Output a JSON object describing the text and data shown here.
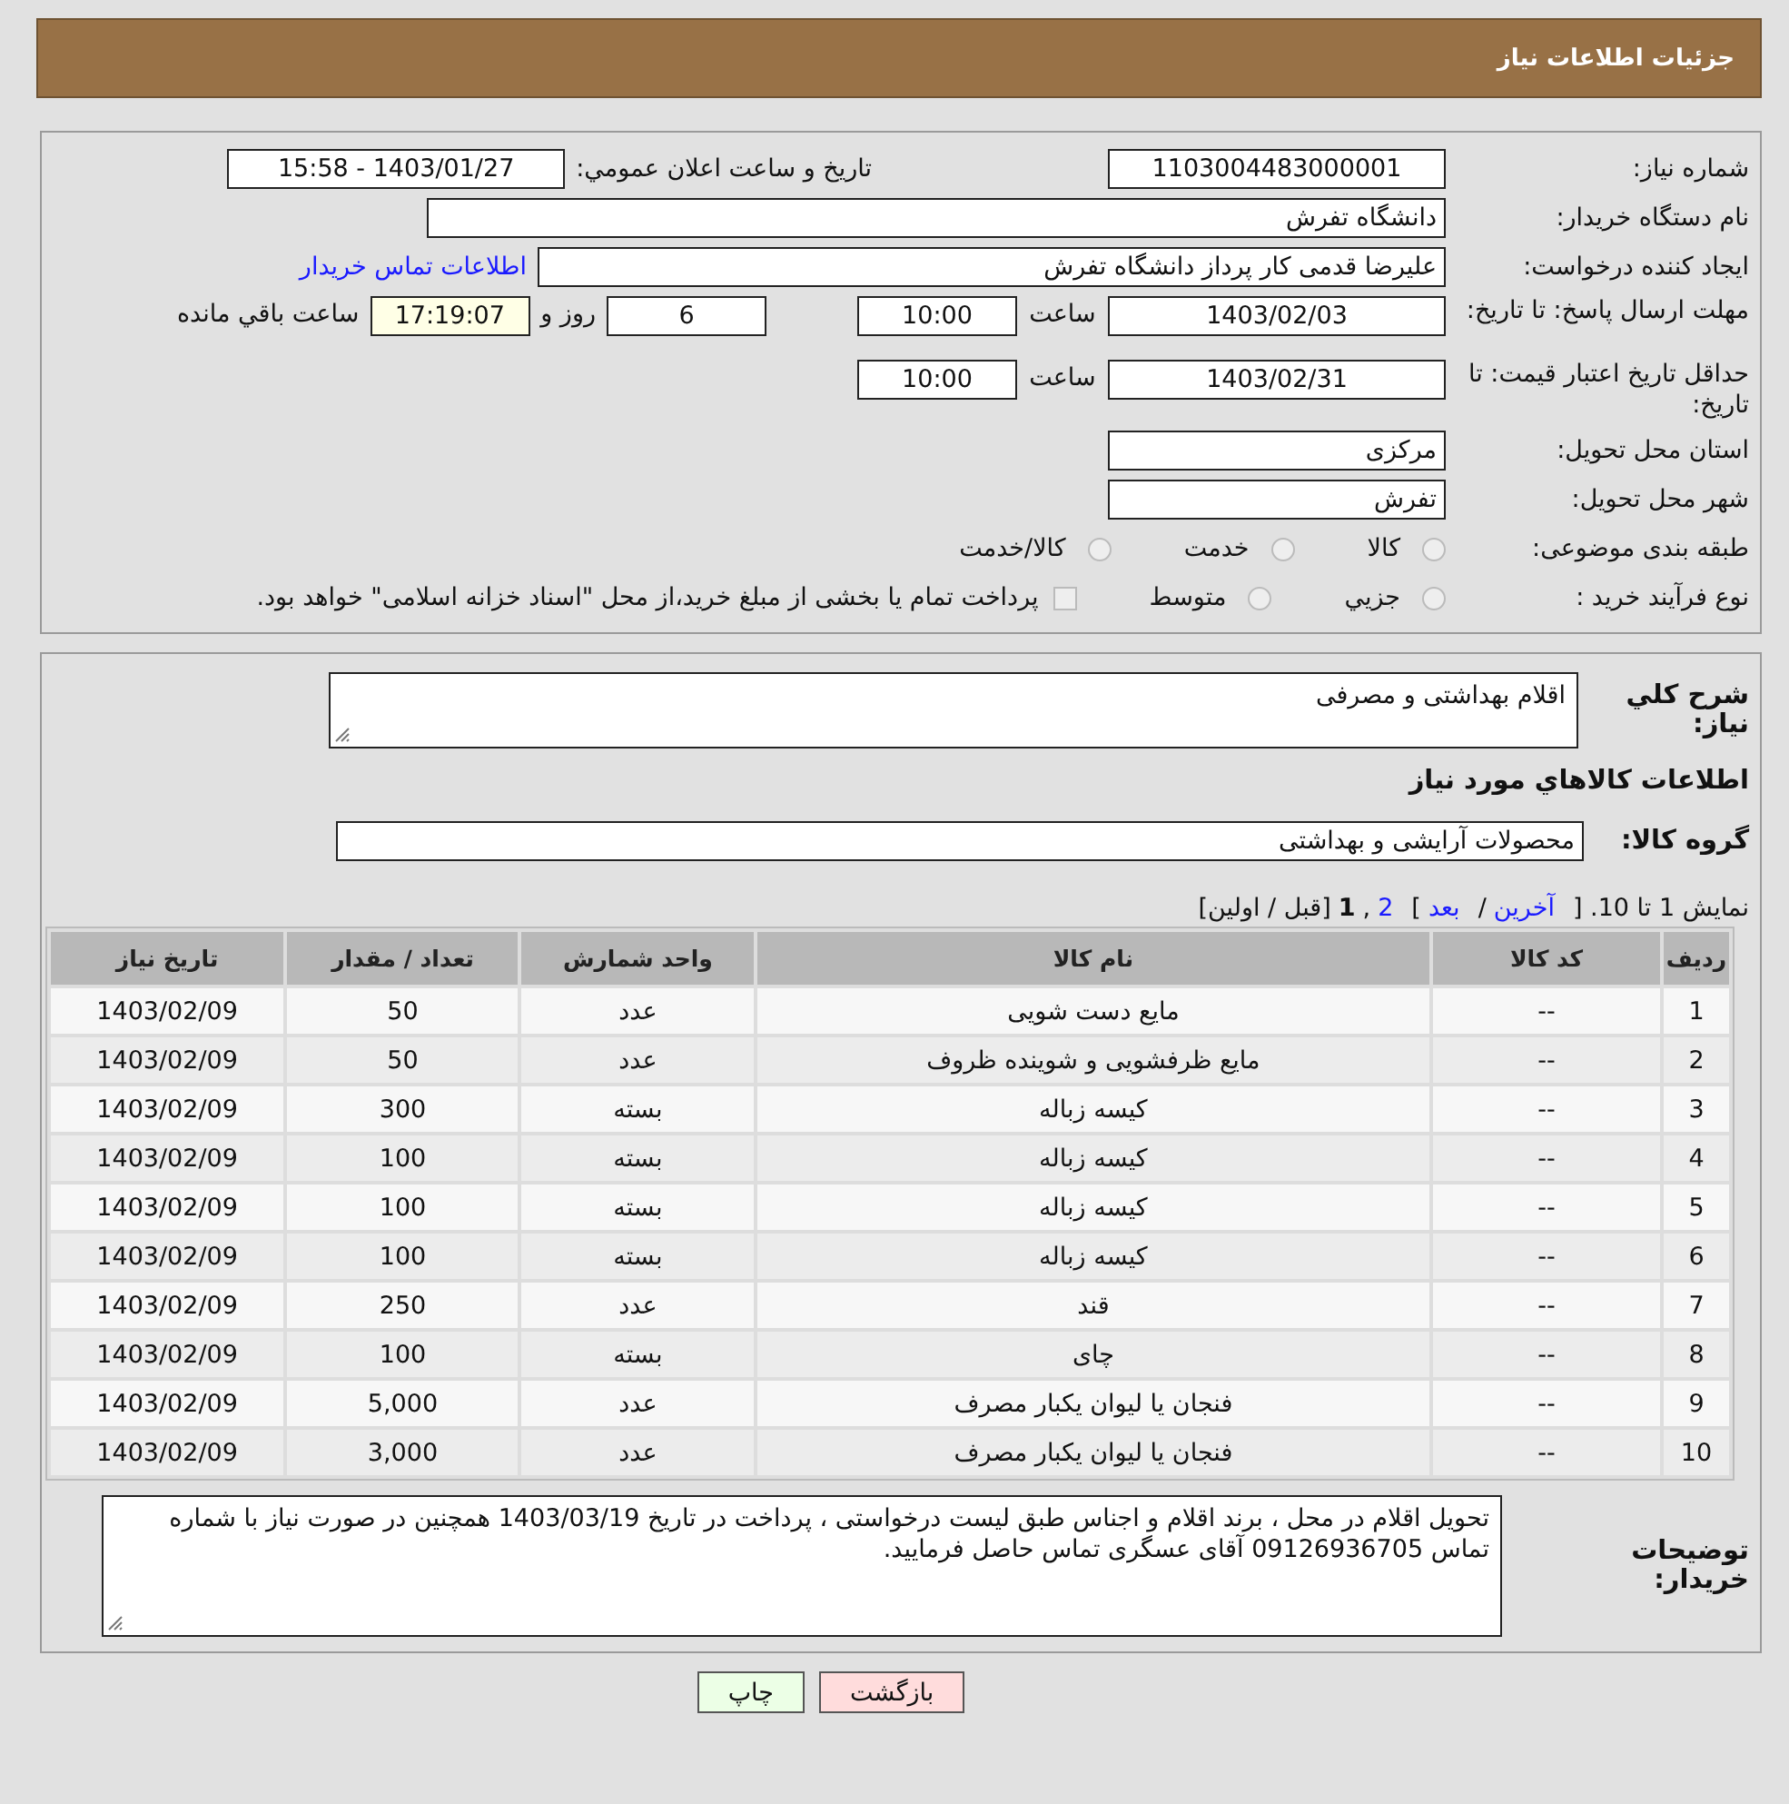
{
  "header": {
    "title": "جزئیات اطلاعات نیاز"
  },
  "need_number": {
    "label": "شماره نیاز:",
    "value": "1103004483000001"
  },
  "announce": {
    "label": "تاریخ و ساعت اعلان عمومي:",
    "value": "1403/01/27 - 15:58"
  },
  "buyer_org": {
    "label": "نام دستگاه خریدار:",
    "value": "دانشگاه تفرش"
  },
  "creator": {
    "label": "ایجاد کننده درخواست:",
    "value": "علیرضا قدمی کار پرداز دانشگاه تفرش",
    "link": "اطلاعات تماس خریدار"
  },
  "reply_deadline": {
    "label": "مهلت ارسال پاسخ: تا تاریخ:",
    "date": "1403/02/03",
    "time_label": "ساعت",
    "time": "10:00",
    "days": "6",
    "days_label": "روز و",
    "remaining": "17:19:07",
    "remaining_label": "ساعت باقي مانده"
  },
  "price_validity": {
    "label": "حداقل تاریخ اعتبار قیمت: تا تاریخ:",
    "date": "1403/02/31",
    "time_label": "ساعت",
    "time": "10:00"
  },
  "province": {
    "label": "استان محل تحویل:",
    "value": "مرکزی"
  },
  "city": {
    "label": "شهر محل تحویل:",
    "value": "تفرش"
  },
  "category": {
    "label": "طبقه بندی موضوعی:",
    "options": [
      {
        "label": "کالا",
        "selected": false
      },
      {
        "label": "خدمت",
        "selected": false
      },
      {
        "label": "کالا/خدمت",
        "selected": false
      }
    ]
  },
  "process": {
    "label": "نوع فرآیند خرید :",
    "options": [
      {
        "label": "جزيي",
        "selected": false
      },
      {
        "label": "متوسط",
        "selected": false
      }
    ],
    "treasury": {
      "label": "پرداخت تمام یا بخشی از مبلغ خرید،از محل \"اسناد خزانه اسلامی\" خواهد بود.",
      "checked": false
    }
  },
  "summary": {
    "label": "شرح کلي نياز:",
    "value": "اقلام بهداشتی و مصرفی"
  },
  "goods_heading": "اطلاعات کالاهاي مورد نياز",
  "goods_group": {
    "label": "گروه کالا:",
    "value": "محصولات آرایشی و بهداشتی"
  },
  "pager": [
    {
      "kind": "text",
      "text": "نمایش 1 تا 10. ["
    },
    {
      "kind": "link",
      "text": "آخرین"
    },
    {
      "kind": "text",
      "text": "/"
    },
    {
      "kind": "link",
      "text": "بعد"
    },
    {
      "kind": "text",
      "text": "]"
    },
    {
      "kind": "link",
      "text": "2"
    },
    {
      "kind": "text",
      "text": ","
    },
    {
      "kind": "current",
      "text": "1"
    },
    {
      "kind": "text",
      "text": "[قبل / اولین]"
    }
  ],
  "table": {
    "columns": [
      "ردیف",
      "کد کالا",
      "نام کالا",
      "واحد شمارش",
      "تعداد / مقدار",
      "تاریخ نیاز"
    ],
    "rows": [
      [
        "1",
        "--",
        "مایع دست شویی",
        "عدد",
        "50",
        "1403/02/09"
      ],
      [
        "2",
        "--",
        "مایع ظرفشویی و شوینده ظروف",
        "عدد",
        "50",
        "1403/02/09"
      ],
      [
        "3",
        "--",
        "کیسه زباله",
        "بسته",
        "300",
        "1403/02/09"
      ],
      [
        "4",
        "--",
        "کیسه زباله",
        "بسته",
        "100",
        "1403/02/09"
      ],
      [
        "5",
        "--",
        "کیسه زباله",
        "بسته",
        "100",
        "1403/02/09"
      ],
      [
        "6",
        "--",
        "کیسه زباله",
        "بسته",
        "100",
        "1403/02/09"
      ],
      [
        "7",
        "--",
        "قند",
        "عدد",
        "250",
        "1403/02/09"
      ],
      [
        "8",
        "--",
        "چای",
        "بسته",
        "100",
        "1403/02/09"
      ],
      [
        "9",
        "--",
        "فنجان یا لیوان یکبار مصرف",
        "عدد",
        "5,000",
        "1403/02/09"
      ],
      [
        "10",
        "--",
        "فنجان یا لیوان یکبار مصرف",
        "عدد",
        "3,000",
        "1403/02/09"
      ]
    ]
  },
  "buyer_notes": {
    "label": "توضیحات خریدار:",
    "value": "تحویل اقلام در محل ، برند اقلام و اجناس طبق لیست درخواستی ، پرداخت در تاریخ 1403/03/19 همچنین در صورت نیاز با شماره تماس 09126936705 آقای عسگری تماس حاصل فرمایید."
  },
  "buttons": [
    {
      "label": "بازگشت",
      "kind": "back"
    },
    {
      "label": "چاپ",
      "kind": "print"
    }
  ]
}
